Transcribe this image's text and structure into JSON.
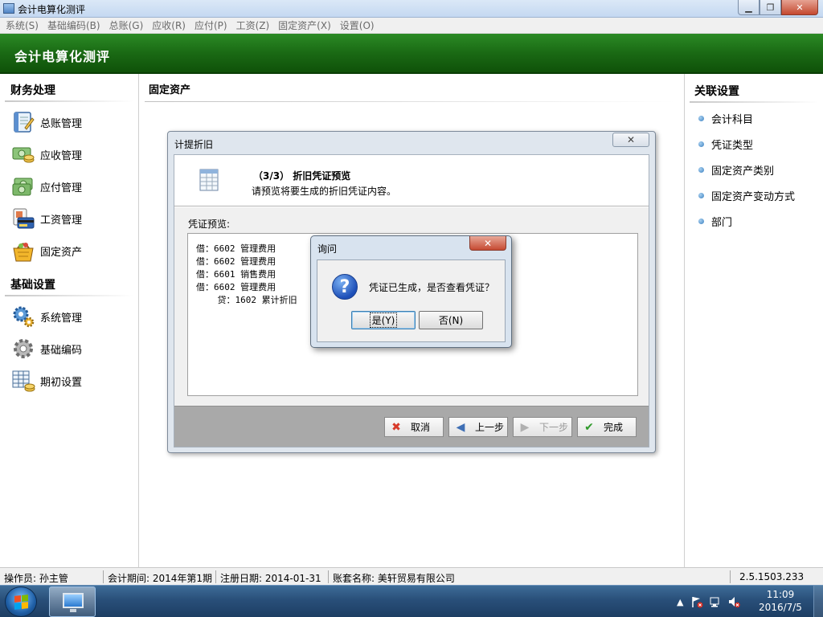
{
  "window": {
    "title": "会计电算化测评",
    "minimize_glyph": "▁",
    "restore_glyph": "❐",
    "close_glyph": "✕"
  },
  "menubar": {
    "items": [
      "系统(S)",
      "基础编码(B)",
      "总账(G)",
      "应收(R)",
      "应付(P)",
      "工资(Z)",
      "固定资产(X)",
      "设置(O)"
    ]
  },
  "header": {
    "title": "会计电算化测评"
  },
  "left_panel": {
    "section1_title": "财务处理",
    "section1_items": [
      {
        "label": "总账管理",
        "icon": "ledger-book-icon"
      },
      {
        "label": "应收管理",
        "icon": "money-in-icon"
      },
      {
        "label": "应付管理",
        "icon": "money-out-icon"
      },
      {
        "label": "工资管理",
        "icon": "payroll-card-icon"
      },
      {
        "label": "固定资产",
        "icon": "basket-icon"
      }
    ],
    "section2_title": "基础设置",
    "section2_items": [
      {
        "label": "系统管理",
        "icon": "gears-icon"
      },
      {
        "label": "基础编码",
        "icon": "gear-icon"
      },
      {
        "label": "期初设置",
        "icon": "table-coins-icon"
      }
    ]
  },
  "main": {
    "title": "固定资产"
  },
  "right_panel": {
    "title": "关联设置",
    "links": [
      "会计科目",
      "凭证类型",
      "固定资产类别",
      "固定资产变动方式",
      "部门"
    ]
  },
  "wizard": {
    "title": "计提折旧",
    "close_glyph": "✕",
    "step": "（3/3） 折旧凭证预览",
    "description": "请预览将要生成的折旧凭证内容。",
    "preview_label": "凭证预览:",
    "preview_lines": [
      "借：6602 管理费用",
      "借：6602 管理费用",
      "借：6601 销售费用",
      "借：6602 管理费用",
      "    贷：1602 累计折旧"
    ],
    "buttons": {
      "cancel": "取消",
      "prev": "上一步",
      "next": "下一步",
      "finish": "完成"
    }
  },
  "ask_dialog": {
    "title": "询问",
    "close_glyph": "✕",
    "message": "凭证已生成，是否查看凭证？",
    "yes_label": "是(Y)",
    "no_label": "否(N)"
  },
  "statusbar": {
    "operator": "操作员: 孙主管",
    "period": "会计期间: 2014年第1期",
    "register_date": "注册日期: 2014-01-31",
    "account_name": "账套名称: 美轩贸易有限公司",
    "version": "2.5.1503.233"
  },
  "taskbar": {
    "time": "11:09",
    "date": "2016/7/5",
    "tray_arrow": "▲"
  },
  "colors": {
    "header_green": "#1a6a14",
    "dialog_frame": "#d8e3ef",
    "close_red": "#c64a32"
  }
}
